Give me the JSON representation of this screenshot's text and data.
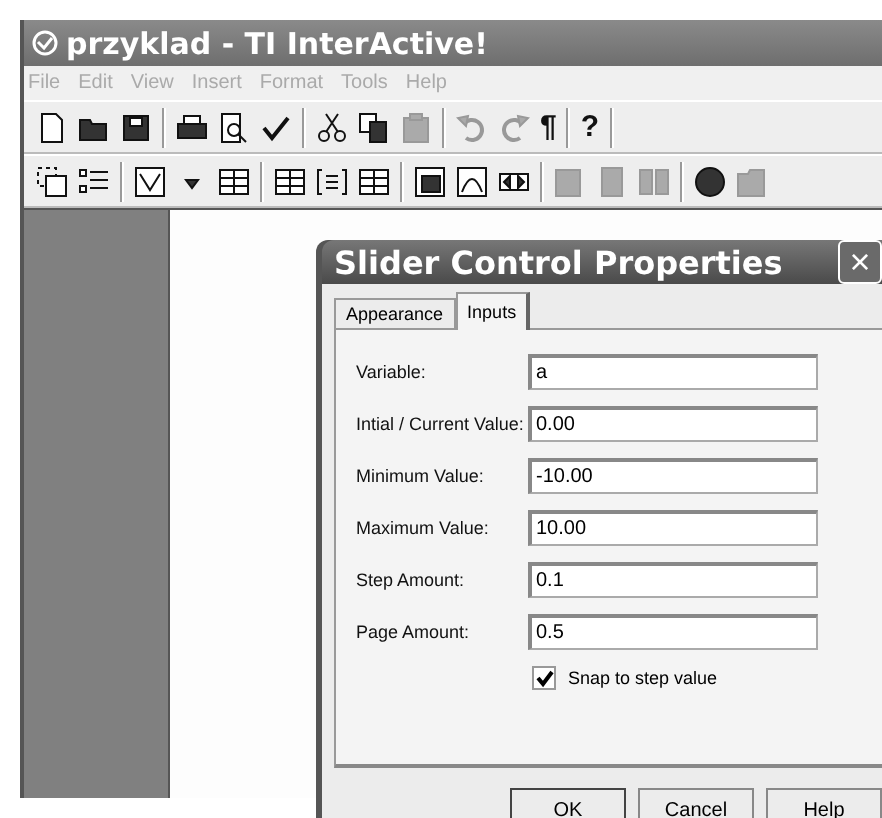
{
  "window": {
    "title": "przyklad - TI InterActive!"
  },
  "menu": [
    "File",
    "Edit",
    "View",
    "Insert",
    "Format",
    "Tools",
    "Help"
  ],
  "toolbar": {
    "pilcrow": "¶",
    "help": "?"
  },
  "dialog": {
    "title": "Slider Control Properties",
    "close": "×",
    "tabs": [
      {
        "label": "Appearance",
        "selected": false
      },
      {
        "label": "Inputs",
        "selected": true
      }
    ],
    "fields": [
      {
        "label": "Variable:",
        "value": "a"
      },
      {
        "label": "Intial / Current Value:",
        "value": "0.00"
      },
      {
        "label": "Minimum Value:",
        "value": "-10.00"
      },
      {
        "label": "Maximum Value:",
        "value": "10.00"
      },
      {
        "label": "Step Amount:",
        "value": "0.1"
      },
      {
        "label": "Page Amount:",
        "value": "0.5"
      }
    ],
    "snap": {
      "label": "Snap to step value",
      "checked": true
    },
    "buttons": [
      "OK",
      "Cancel",
      "Help"
    ]
  }
}
